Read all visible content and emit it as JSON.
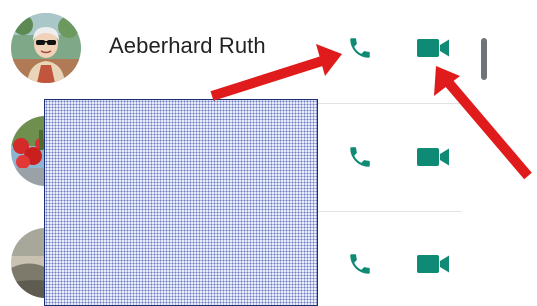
{
  "contacts": [
    {
      "name": "Aeberhard Ruth",
      "avatar_icon": "profile-photo-woman-sunglasses",
      "call_icon": "phone-icon",
      "video_icon": "video-camera-icon"
    },
    {
      "name": "",
      "avatar_icon": "profile-photo-red-flowers",
      "call_icon": "phone-icon",
      "video_icon": "video-camera-icon"
    },
    {
      "name": "",
      "avatar_icon": "profile-photo-landscape",
      "call_icon": "phone-icon",
      "video_icon": "video-camera-icon"
    }
  ],
  "colors": {
    "action_icon": "#0f8a75",
    "annotation_arrow": "#e01b1b",
    "redaction_border": "#1c2e6e",
    "scrollbar": "#6e7479",
    "name_text": "#222222",
    "divider": "#e2e2e2"
  }
}
